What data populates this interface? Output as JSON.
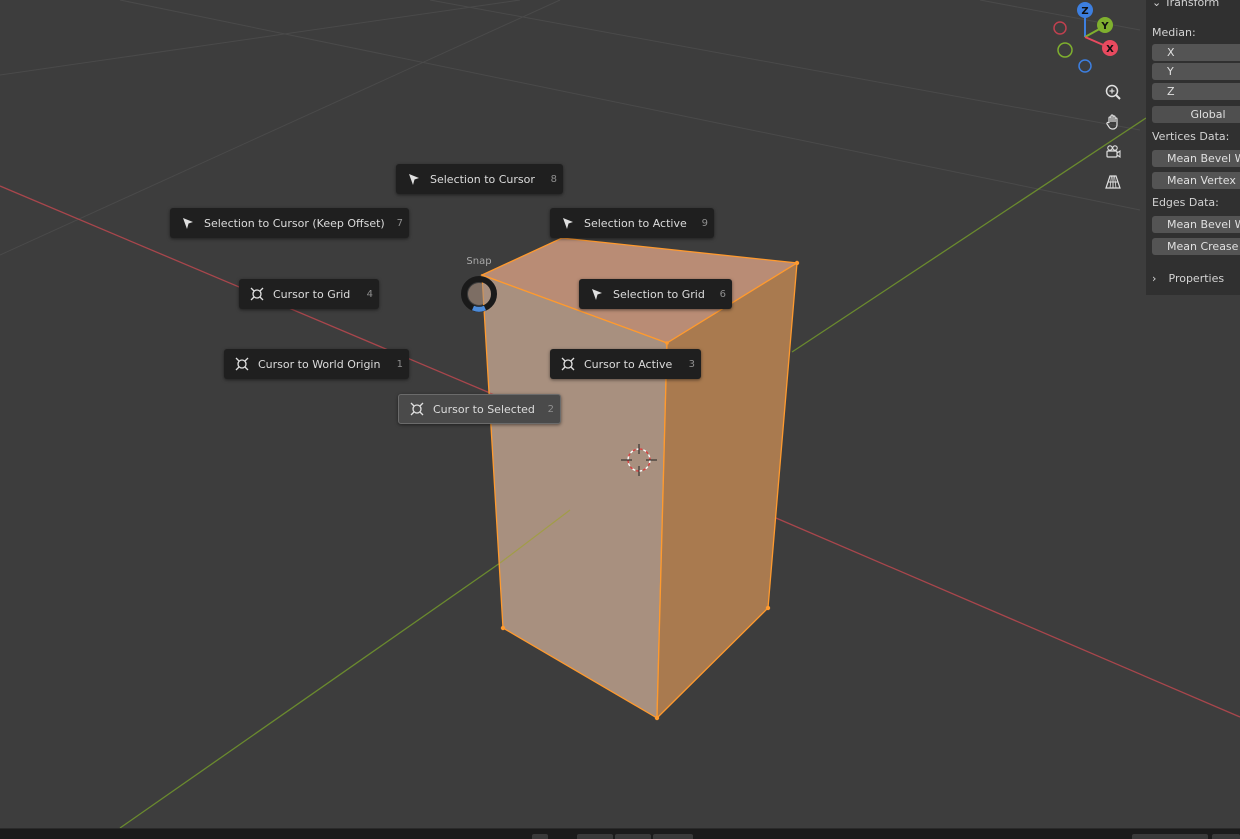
{
  "pie_menu": {
    "title": "Snap",
    "items": [
      {
        "label": "Selection to Cursor",
        "shortcut": "8",
        "icon": "cursor-arrow-icon"
      },
      {
        "label": "Selection to Cursor (Keep Offset)",
        "shortcut": "7",
        "icon": "cursor-arrow-icon"
      },
      {
        "label": "Selection to Active",
        "shortcut": "9",
        "icon": "cursor-arrow-icon"
      },
      {
        "label": "Cursor to Grid",
        "shortcut": "4",
        "icon": "3d-cursor-icon"
      },
      {
        "label": "Selection to Grid",
        "shortcut": "6",
        "icon": "cursor-arrow-icon"
      },
      {
        "label": "Cursor to World Origin",
        "shortcut": "1",
        "icon": "3d-cursor-icon"
      },
      {
        "label": "Cursor to Active",
        "shortcut": "3",
        "icon": "3d-cursor-icon"
      },
      {
        "label": "Cursor to Selected",
        "shortcut": "2",
        "icon": "3d-cursor-icon",
        "active": true
      }
    ]
  },
  "navigation_gizmo": {
    "axes": {
      "x": "X",
      "y": "Y",
      "z": "Z"
    },
    "colors": {
      "x": "#e84a5f",
      "y": "#7fb02e",
      "z": "#3d7fe0"
    },
    "tools": [
      "zoom-icon",
      "pan-hand-icon",
      "camera-icon",
      "perspective-grid-icon"
    ]
  },
  "sidebar": {
    "section_title": "Transform",
    "median_label": "Median:",
    "fields": [
      "X",
      "Y",
      "Z"
    ],
    "orientation_button": "Global",
    "vertices_label": "Vertices Data:",
    "vertices_fields": [
      "Mean Bevel W",
      "Mean Vertex C"
    ],
    "edges_label": "Edges Data:",
    "edges_fields": [
      "Mean Bevel W",
      "Mean Crease"
    ],
    "properties_label": "Properties"
  },
  "theme": {
    "viewport_bg": "#3d3d3d",
    "selection_orange": "#ff9a2e",
    "mesh_fill": "#b08a76"
  }
}
